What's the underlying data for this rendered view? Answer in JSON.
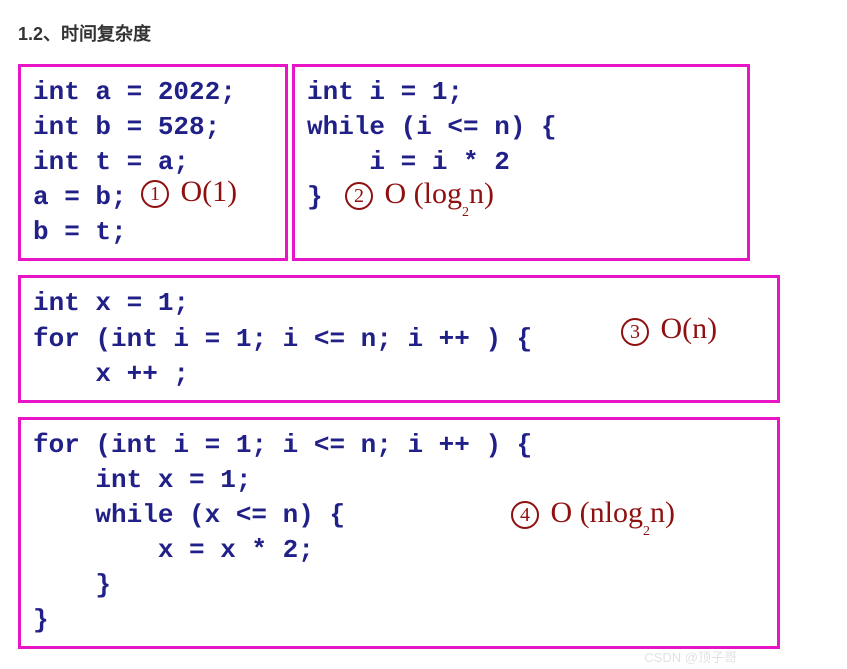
{
  "heading": "1.2、时间复杂度",
  "box1": {
    "lines": [
      "int a = 2022;",
      "int b = 528;",
      "int t = a;",
      "a = b;",
      "b = t;"
    ],
    "annotation_num": "1",
    "annotation_text": "O(1)"
  },
  "box2": {
    "lines": [
      "int i = 1;",
      "while (i <= n) {",
      "    i = i * 2",
      "}"
    ],
    "annotation_num": "2",
    "annotation_text_prefix": "O (log",
    "annotation_sub": "2",
    "annotation_text_suffix": "n)"
  },
  "box3": {
    "lines": [
      "int x = 1;",
      "for (int i = 1; i <= n; i ++ ) {",
      "    x ++ ;"
    ],
    "annotation_num": "3",
    "annotation_text": "O(n)"
  },
  "box4": {
    "lines": [
      "for (int i = 1; i <= n; i ++ ) {",
      "    int x = 1;",
      "    while (x <= n) {",
      "        x = x * 2;",
      "    }",
      "}"
    ],
    "annotation_num": "4",
    "annotation_text_prefix": "O (nlog",
    "annotation_sub": "2",
    "annotation_text_suffix": "n)"
  },
  "watermark": "CSDN @顶子哥"
}
